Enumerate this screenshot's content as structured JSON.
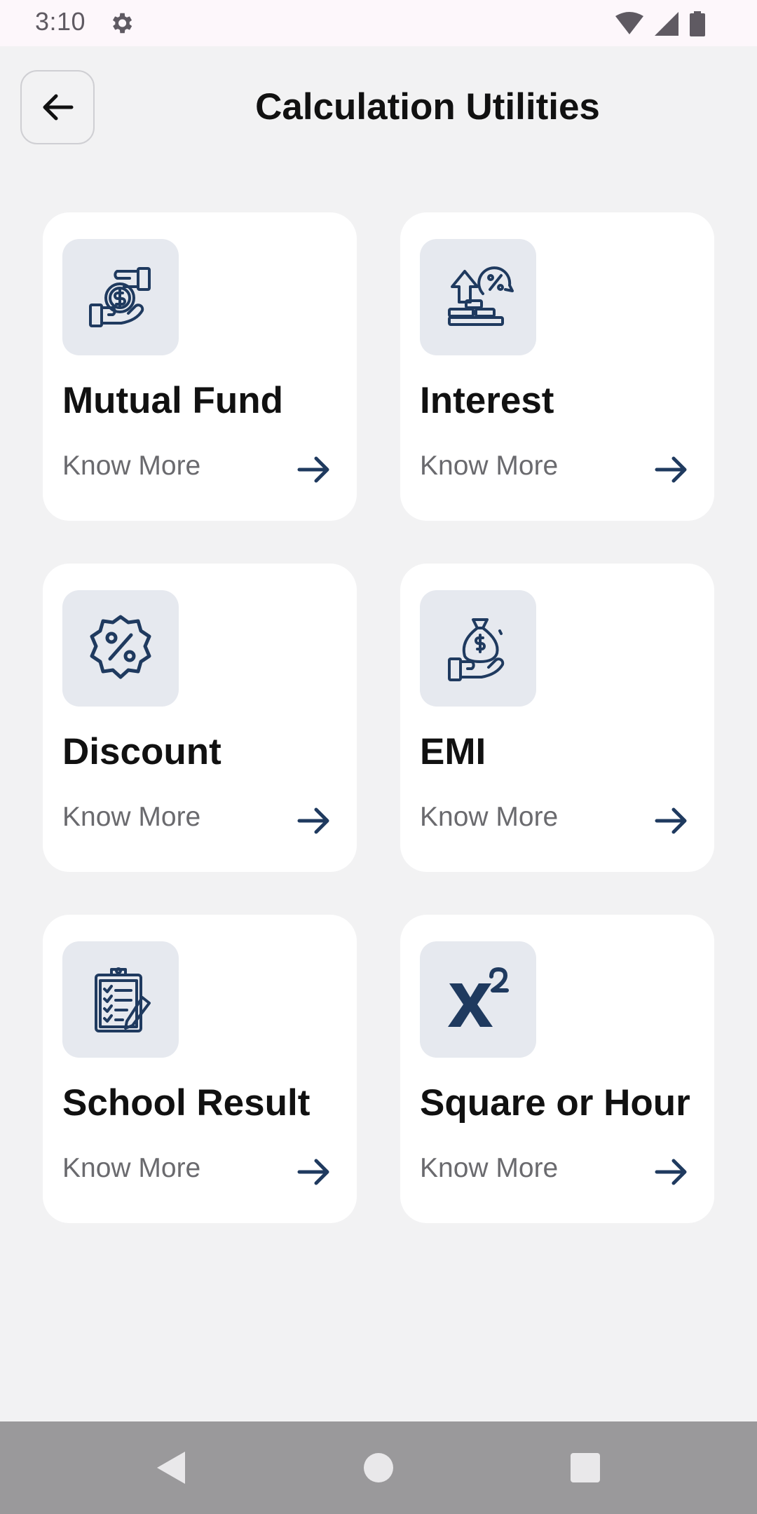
{
  "status_bar": {
    "time": "3:10",
    "icons": [
      "settings-icon",
      "wifi-icon",
      "signal-icon",
      "battery-icon"
    ]
  },
  "header": {
    "title": "Calculation Utilities",
    "back_icon": "arrow-left-icon"
  },
  "cards": [
    {
      "title": "Mutual Fund",
      "link": "Know More",
      "icon": "hand-coin-icon"
    },
    {
      "title": "Interest",
      "link": "Know More",
      "icon": "interest-growth-icon"
    },
    {
      "title": "Discount",
      "link": "Know More",
      "icon": "discount-badge-icon"
    },
    {
      "title": "EMI",
      "link": "Know More",
      "icon": "money-bag-hand-icon"
    },
    {
      "title": "School Result",
      "link": "Know More",
      "icon": "clipboard-checklist-icon"
    },
    {
      "title": "Square or Hour",
      "link": "Know More",
      "icon": "x-squared-icon"
    }
  ],
  "colors": {
    "icon_navy": "#1f3a5f",
    "icon_box": "#e6e9ef",
    "background": "#f2f2f3",
    "card": "#ffffff"
  },
  "nav_bar": {
    "buttons": [
      "back-triangle-icon",
      "home-circle-icon",
      "recents-square-icon"
    ]
  }
}
